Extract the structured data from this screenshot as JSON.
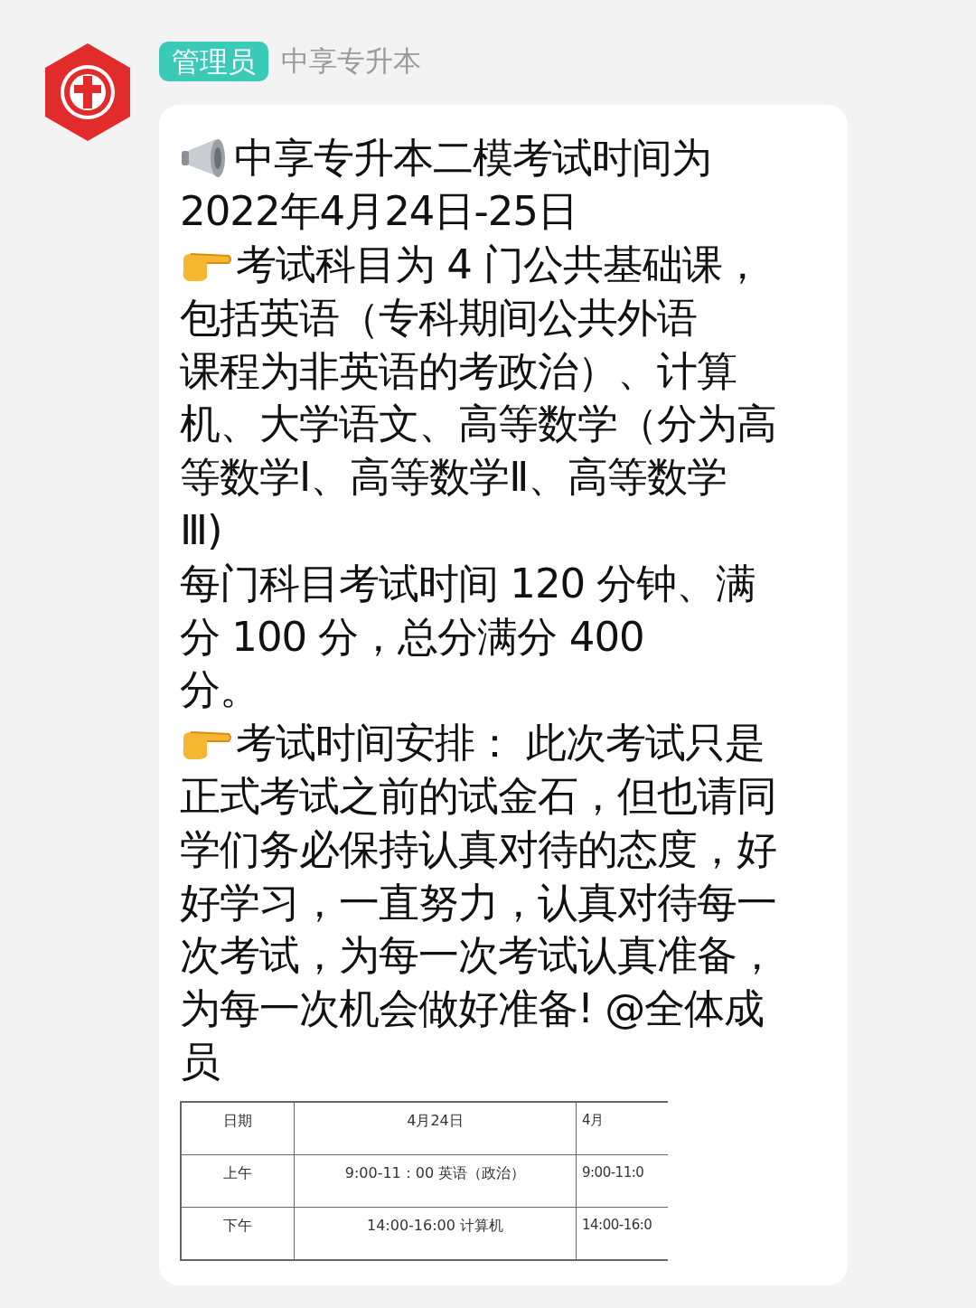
{
  "sender": {
    "role_badge": "管理员",
    "name": "中享专升本"
  },
  "message": {
    "lines": [
      {
        "kind": "megaphone",
        "text": "中享专升本二模考试时间为"
      },
      {
        "kind": "plain",
        "text": "2022年4月24日-25日"
      },
      {
        "kind": "pointer",
        "text": "考试科目为 4 门公共基础课，"
      },
      {
        "kind": "plain",
        "text": "包括英语（专科期间公共外语"
      },
      {
        "kind": "plain",
        "text": "课程为非英语的考政治）、计算"
      },
      {
        "kind": "plain",
        "text": "机、大学语文、高等数学（分为高"
      },
      {
        "kind": "plain",
        "text": "等数学Ⅰ、高等数学Ⅱ、高等数学"
      },
      {
        "kind": "plain",
        "text": "Ⅲ)"
      },
      {
        "kind": "plain",
        "text": "每门科目考试时间 120 分钟、满"
      },
      {
        "kind": "plain",
        "text": "分 100 分，总分满分 400"
      },
      {
        "kind": "plain",
        "text": "分。"
      },
      {
        "kind": "pointer",
        "text": "考试时间安排：  此次考试只是"
      },
      {
        "kind": "plain",
        "text": "正式考试之前的试金石，但也请同"
      },
      {
        "kind": "plain",
        "text": "学们务必保持认真对待的态度，好"
      },
      {
        "kind": "plain",
        "text": "好学习，一直努力，认真对待每一"
      },
      {
        "kind": "plain",
        "text": "次考试，为每一次考试认真准备，"
      },
      {
        "kind": "plain",
        "text": "为每一次机会做好准备! @全体成"
      },
      {
        "kind": "plain",
        "text": "员"
      }
    ],
    "table": {
      "rows": [
        [
          "日期",
          "4月24日",
          "4月"
        ],
        [
          "上午",
          "9:00-11：00 英语（政治）",
          "9:00-11:0"
        ],
        [
          "下午",
          "14:00-16:00 计算机",
          "14:00-16:0"
        ]
      ]
    }
  }
}
